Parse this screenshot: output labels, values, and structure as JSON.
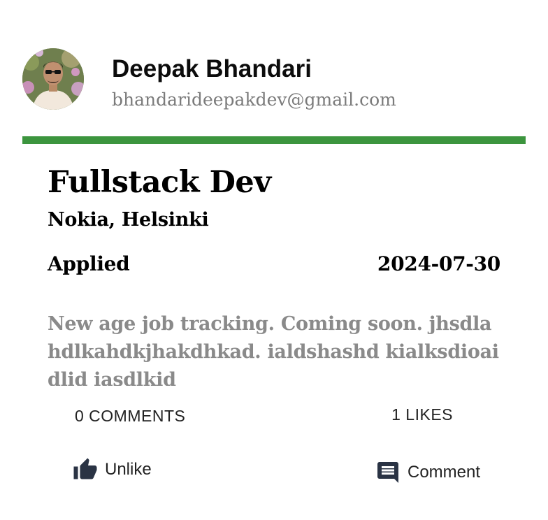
{
  "colors": {
    "accent": "#3c953e",
    "icon": "#2a3344",
    "muted_text": "#8a8a8a"
  },
  "profile": {
    "name": "Deepak Bhandari",
    "email": "bhandarideepakdev@gmail.com",
    "avatar_icon": "user-avatar-photo"
  },
  "job": {
    "title": "Fullstack Dev",
    "company": "Nokia, Helsinki",
    "status": "Applied",
    "date": "2024-07-30",
    "description": "New age job tracking. Coming soon. jhsdlahdlkahdkjhakdhkad. ialdshashd kialksdioaidlid iasdlkid"
  },
  "stats": {
    "comments": "0 COMMENTS",
    "likes": "1 LIKES"
  },
  "actions": {
    "unlike_label": "Unlike",
    "unlike_icon": "thumbs-up-icon",
    "comment_label": "Comment",
    "comment_icon": "comment-icon"
  }
}
